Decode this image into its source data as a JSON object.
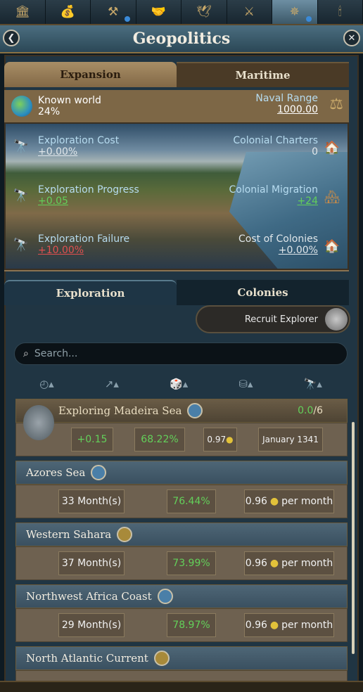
{
  "topbar": {
    "icons": [
      "court-icon",
      "economy-icon",
      "production-icon",
      "diplomacy-icon",
      "military-icon",
      "government-icon",
      "geopolitics-icon",
      "religion-icon"
    ],
    "active_index": 6
  },
  "header": {
    "title": "Geopolitics"
  },
  "top_tabs": [
    "Expansion",
    "Maritime"
  ],
  "known_world": {
    "label": "Known world",
    "value": "24%"
  },
  "naval_range": {
    "label": "Naval Range",
    "value": "1000.00"
  },
  "stats": {
    "exploration_cost": {
      "label": "Exploration Cost",
      "value": "+0.00%"
    },
    "colonial_charters": {
      "label": "Colonial Charters",
      "value": "0"
    },
    "exploration_progress": {
      "label": "Exploration Progress",
      "value": "+0.05"
    },
    "colonial_migration": {
      "label": "Colonial Migration",
      "value": "+24"
    },
    "exploration_failure": {
      "label": "Exploration Failure",
      "value": "+10.00%"
    },
    "cost_of_colonies": {
      "label": "Cost of Colonies",
      "value": "+0.00%"
    }
  },
  "sub_tabs": [
    "Exploration",
    "Colonies"
  ],
  "recruit": {
    "label": "Recruit Explorer"
  },
  "search": {
    "placeholder": "Search..."
  },
  "current": {
    "title": "Exploring Madeira Sea",
    "count": "0.0",
    "max": "/6",
    "progress": "+0.15",
    "chance": "68.22%",
    "cost": "0.97",
    "date": "January 1341"
  },
  "areas": [
    {
      "name": "Azores Sea",
      "duration": "33 Month(s)",
      "chance": "76.44%",
      "cost": "0.96",
      "per": "per month",
      "type": "sea"
    },
    {
      "name": "Western Sahara",
      "duration": "37 Month(s)",
      "chance": "73.99%",
      "cost": "0.96",
      "per": "per month",
      "type": "land"
    },
    {
      "name": "Northwest Africa Coast",
      "duration": "29 Month(s)",
      "chance": "78.97%",
      "cost": "0.96",
      "per": "per month",
      "type": "sea"
    },
    {
      "name": "North Atlantic Current",
      "duration": "",
      "chance": "",
      "cost": "",
      "per": "",
      "type": "land"
    }
  ],
  "colors": {
    "positive": "#63d05a",
    "negative": "#e05050",
    "accent": "#c9a96a"
  }
}
